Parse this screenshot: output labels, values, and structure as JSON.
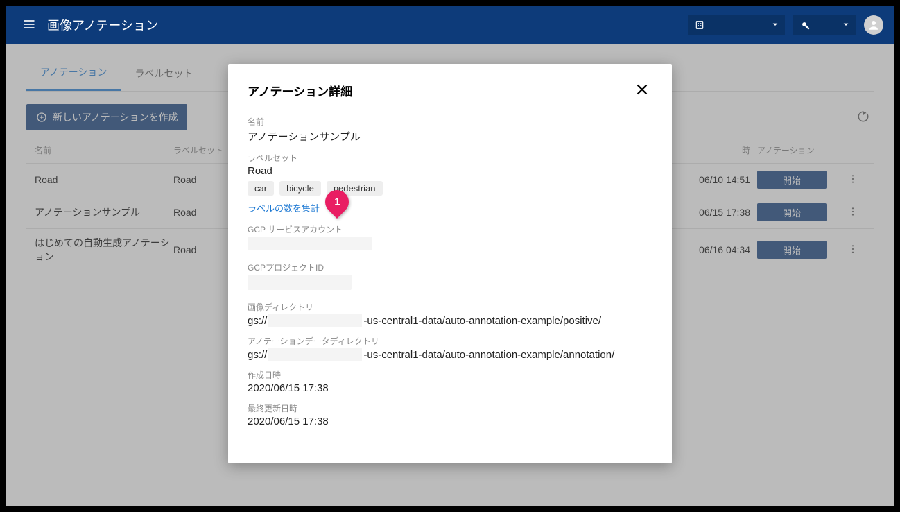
{
  "header": {
    "title": "画像アノテーション"
  },
  "tabs": {
    "annotation": "アノテーション",
    "labelset": "ラベルセット"
  },
  "toolbar": {
    "new_button": "新しいアノテーションを作成"
  },
  "table": {
    "headers": {
      "name": "名前",
      "labelset": "ラベルセット",
      "date": "時",
      "annotation": "アノテーション"
    },
    "rows": [
      {
        "name": "Road",
        "labelset": "Road",
        "date": "06/10 14:51",
        "action": "開始"
      },
      {
        "name": "アノテーションサンプル",
        "labelset": "Road",
        "date": "06/15 17:38",
        "action": "開始"
      },
      {
        "name": "はじめての自動生成アノテーション",
        "labelset": "Road",
        "date": "06/16 04:34",
        "action": "開始"
      }
    ]
  },
  "modal": {
    "title": "アノテーション詳細",
    "name_label": "名前",
    "name_value": "アノテーションサンプル",
    "labelset_label": "ラベルセット",
    "labelset_value": "Road",
    "chips": [
      "car",
      "bicycle",
      "pedestrian"
    ],
    "aggregate_link": "ラベルの数を集計",
    "gcp_sa_label": "GCP サービスアカウント",
    "gcp_project_label": "GCPプロジェクトID",
    "image_dir_label": "画像ディレクトリ",
    "image_dir_prefix": "gs://",
    "image_dir_suffix": "-us-central1-data/auto-annotation-example/positive/",
    "anno_dir_label": "アノテーションデータディレクトリ",
    "anno_dir_prefix": "gs://",
    "anno_dir_suffix": "-us-central1-data/auto-annotation-example/annotation/",
    "created_label": "作成日時",
    "created_value": "2020/06/15 17:38",
    "updated_label": "最終更新日時",
    "updated_value": "2020/06/15 17:38"
  },
  "pin": {
    "number": "1"
  }
}
